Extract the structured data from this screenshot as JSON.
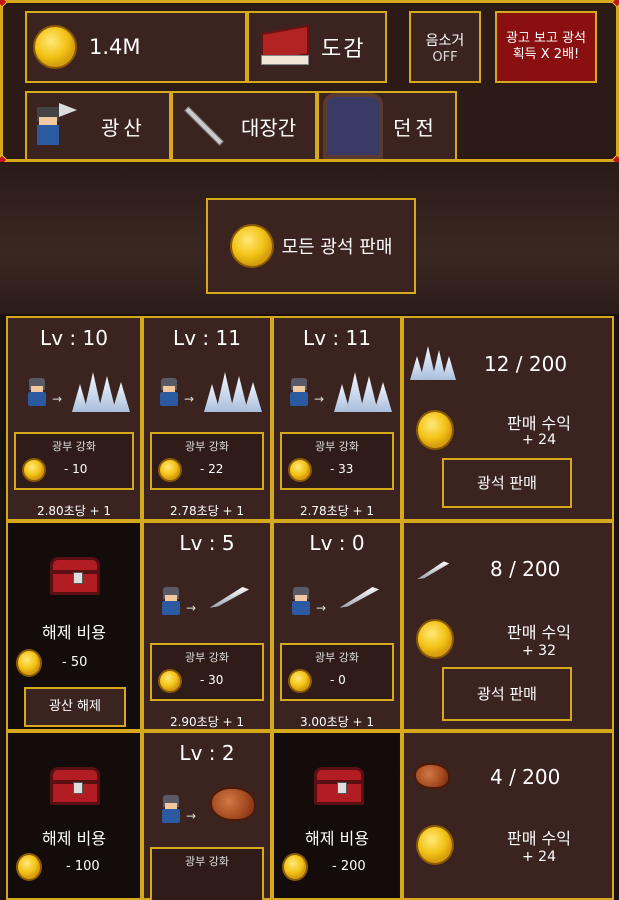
{
  "header": {
    "gold": "1.4M",
    "collection_label": "도감",
    "sound_label": "음소거",
    "sound_state": "OFF",
    "ad_label": "광고 보고 광석 획득 X 2배!"
  },
  "nav": [
    {
      "label": "광산",
      "icon": "miner-axe-icon"
    },
    {
      "label": "대장간",
      "icon": "sword-icon"
    },
    {
      "label": "던전",
      "icon": "dungeon-door-icon"
    }
  ],
  "sell_all_label": "모든 광석 판매",
  "rows": [
    {
      "slots": [
        {
          "type": "miner",
          "level": "Lv : 10",
          "upgrade_label": "광부 강화",
          "cost": "- 10",
          "rate": "2.80초당 + 1",
          "ore": "crystal"
        },
        {
          "type": "miner",
          "level": "Lv : 11",
          "upgrade_label": "광부 강화",
          "cost": "- 22",
          "rate": "2.78초당 + 1",
          "ore": "crystal"
        },
        {
          "type": "miner",
          "level": "Lv : 11",
          "upgrade_label": "광부 강화",
          "cost": "- 33",
          "rate": "2.78초당 + 1",
          "ore": "crystal"
        }
      ],
      "summary": {
        "count": "12 / 200",
        "profit_label": "판매 수익",
        "profit": "+ 24",
        "sell_label": "광석 판매",
        "ore": "crystal"
      }
    },
    {
      "slots": [
        {
          "type": "locked",
          "unlock_label": "해제 비용",
          "cost": "- 50",
          "button": "광산 해제"
        },
        {
          "type": "miner",
          "level": "Lv : 5",
          "upgrade_label": "광부 강화",
          "cost": "- 30",
          "rate": "2.90초당 + 1",
          "ore": "blade"
        },
        {
          "type": "miner",
          "level": "Lv : 0",
          "upgrade_label": "광부 강화",
          "cost": "- 0",
          "rate": "3.00초당 + 1",
          "ore": "blade"
        }
      ],
      "summary": {
        "count": "8 / 200",
        "profit_label": "판매 수익",
        "profit": "+ 32",
        "sell_label": "광석 판매",
        "ore": "blade"
      }
    },
    {
      "slots": [
        {
          "type": "locked",
          "unlock_label": "해제 비용",
          "cost": "- 100"
        },
        {
          "type": "miner",
          "level": "Lv : 2",
          "upgrade_label": "광부 강화",
          "ore": "copper"
        },
        {
          "type": "locked",
          "unlock_label": "해제 비용",
          "cost": "- 200"
        }
      ],
      "summary": {
        "count": "4 / 200",
        "profit_label": "판매 수익",
        "profit": "+ 24",
        "ore": "copper"
      }
    }
  ]
}
